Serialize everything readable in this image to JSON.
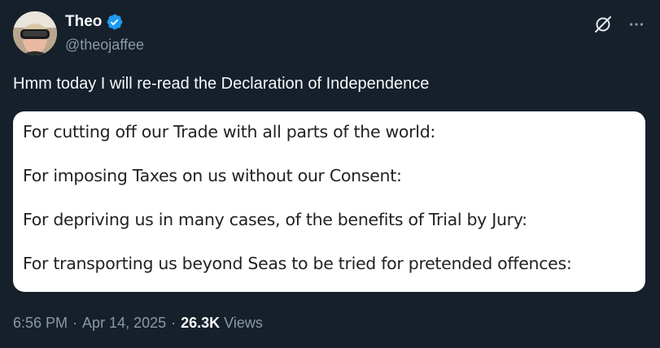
{
  "author": {
    "display_name": "Theo",
    "handle": "@theojaffee",
    "verified": true
  },
  "tweet": {
    "text": "Hmm today I will re-read the Declaration of Independence"
  },
  "media": {
    "lines": [
      "For cutting off our Trade with all parts of the world:",
      "For imposing Taxes on us without our Consent:",
      "For depriving us in many cases, of the benefits of Trial by Jury:",
      "For transporting us beyond Seas to be tried for pretended offences:"
    ]
  },
  "meta": {
    "time": "6:56 PM",
    "separator": "·",
    "date": "Apr 14, 2025",
    "views_count": "26.3K",
    "views_label": "Views"
  },
  "icons": {
    "verified": "verified-badge-icon",
    "grok": "grok-icon",
    "more": "more-icon"
  },
  "colors": {
    "background": "#15202b",
    "text_primary": "#f7f9f9",
    "text_secondary": "#8b98a5",
    "verified_blue": "#1d9bf0",
    "media_background": "#ffffff"
  }
}
